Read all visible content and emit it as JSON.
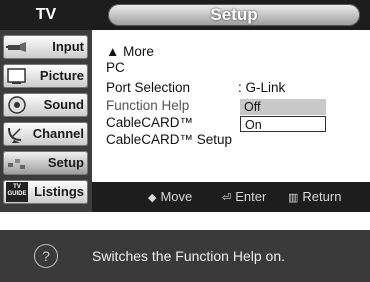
{
  "sidebar": {
    "header": "TV",
    "items": [
      {
        "label": "Input",
        "icon": "input-plug-icon"
      },
      {
        "label": "Picture",
        "icon": "picture-icon"
      },
      {
        "label": "Sound",
        "icon": "sound-icon"
      },
      {
        "label": "Channel",
        "icon": "channel-dish-icon"
      },
      {
        "label": "Setup",
        "icon": "setup-icon"
      },
      {
        "label": "Listings",
        "icon": "tv-guide-icon",
        "badge": "TV GUIDE"
      }
    ]
  },
  "menu": {
    "title": "Setup",
    "rows": [
      {
        "label": "▲ More"
      },
      {
        "label": "PC"
      },
      {
        "label": "Port Selection",
        "value": ": G-Link"
      },
      {
        "label": "Function Help"
      },
      {
        "label": "CableCARD™"
      },
      {
        "label": "CableCARD™ Setup"
      }
    ],
    "options": [
      "Off",
      "On"
    ]
  },
  "hints": {
    "move": "Move",
    "enter": "Enter",
    "return": "Return"
  },
  "help": {
    "icon": "?",
    "text": "Switches the Function Help on."
  }
}
